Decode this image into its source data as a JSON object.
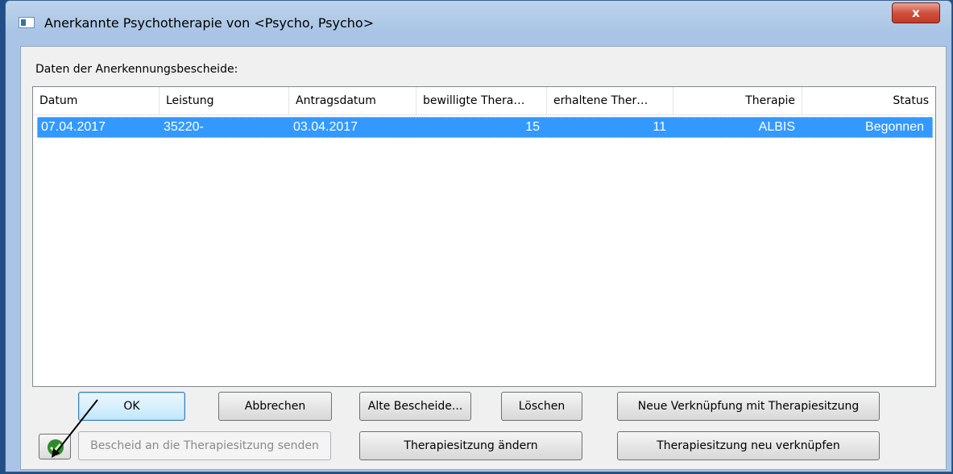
{
  "window": {
    "title": "Anerkannte Psychotherapie von <Psycho, Psycho>",
    "close_label": "x"
  },
  "section_label": "Daten der Anerkennungsbescheide:",
  "table": {
    "columns": [
      "Datum",
      "Leistung",
      "Antragsdatum",
      "bewilligte Thera…",
      "erhaltene Ther…",
      "Therapie",
      "Status"
    ],
    "rows": [
      [
        "07.04.2017",
        "35220-",
        "03.04.2017",
        "15",
        "11",
        "ALBIS",
        "Begonnen"
      ]
    ]
  },
  "buttons": {
    "ok": "OK",
    "abbrechen": "Abbrechen",
    "alte_bescheide": "Alte Bescheide...",
    "loeschen": "Löschen",
    "neue_verknuepfung": "Neue Verknüpfung mit Therapiesitzung",
    "bescheid_senden": "Bescheid an die Therapiesitzung senden",
    "therapiesitzung_aendern": "Therapiesitzung ändern",
    "therapiesitzung_neu": "Therapiesitzung neu verknüpfen"
  },
  "colors": {
    "selection": "#3399ff",
    "titlebar": "#a9c4e4",
    "close": "#c13b28"
  }
}
